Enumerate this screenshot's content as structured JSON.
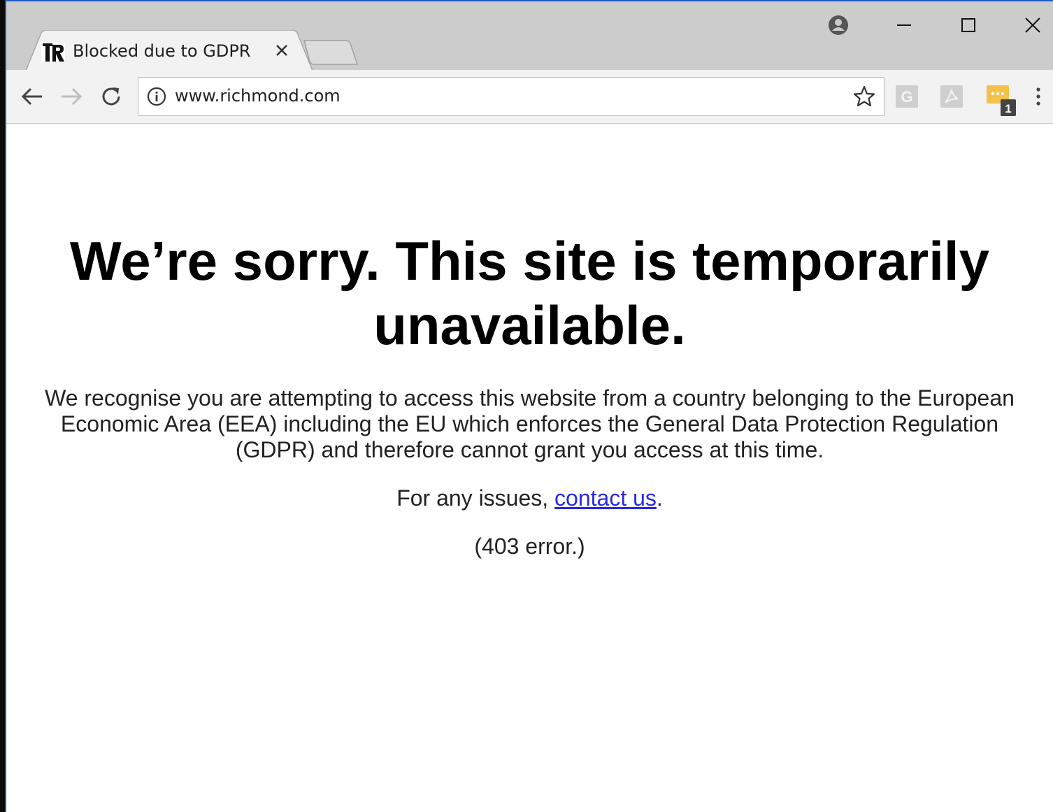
{
  "browser": {
    "tab": {
      "title": "Blocked due to GDPR",
      "favicon": "newspaper-logo-icon",
      "close_icon": "close-icon"
    },
    "new_tab_icon": "new-tab-icon",
    "window_controls": [
      "account-icon",
      "minimize-icon",
      "maximize-icon",
      "close-window-icon"
    ],
    "nav": [
      "back-arrow-icon",
      "forward-arrow-icon",
      "reload-icon"
    ],
    "address_bar": {
      "url": "www.richmond.com",
      "info_icon": "info-icon",
      "bookmark_icon": "star-icon"
    },
    "extensions": [
      {
        "name": "grammar-extension-icon",
        "label": "G"
      },
      {
        "name": "pdf-extension-icon"
      },
      {
        "name": "chat-extension-icon",
        "badge": "1"
      }
    ],
    "menu_icon": "kebab-menu-icon"
  },
  "page": {
    "headline": "We’re sorry. This site is temporarily unavailable.",
    "body": "We recognise you are attempting to access this website from a country belonging to the European Economic Area (EEA) including the EU which enforces the General Data Protection Regulation (GDPR) and therefore cannot grant you access at this time.",
    "contact_prefix": "For any issues, ",
    "contact_link": "contact us",
    "contact_suffix": ".",
    "error": "(403 error.)"
  },
  "colors": {
    "frame": "#cccccc",
    "toolbar": "#f2f2f2",
    "link": "#2828e8",
    "window_border": "#1a59c4"
  }
}
